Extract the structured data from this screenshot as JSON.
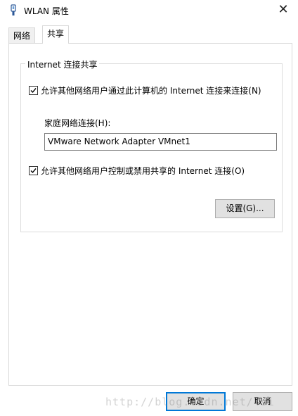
{
  "window": {
    "title": "WLAN 属性",
    "close_glyph": "✕"
  },
  "tabs": [
    {
      "label": "网络",
      "active": false
    },
    {
      "label": "共享",
      "active": true
    }
  ],
  "sharing": {
    "group_title": "Internet 连接共享",
    "allow_connect_label": "允许其他网络用户通过此计算机的 Internet 连接来连接(N)",
    "allow_connect_checked": true,
    "home_network_label": "家庭网络连接(H):",
    "home_network_value": "VMware Network Adapter VMnet1",
    "allow_control_label": "允许其他网络用户控制或禁用共享的 Internet 连接(O)",
    "allow_control_checked": true,
    "settings_button": "设置(G)..."
  },
  "footer": {
    "ok_button": "确定",
    "cancel_button": "取消"
  },
  "watermark": "http://blog.csdn.net/  si",
  "colors": {
    "accent": "#0078d7",
    "button_bg": "#e1e1e1",
    "border": "#d9d9d9"
  }
}
